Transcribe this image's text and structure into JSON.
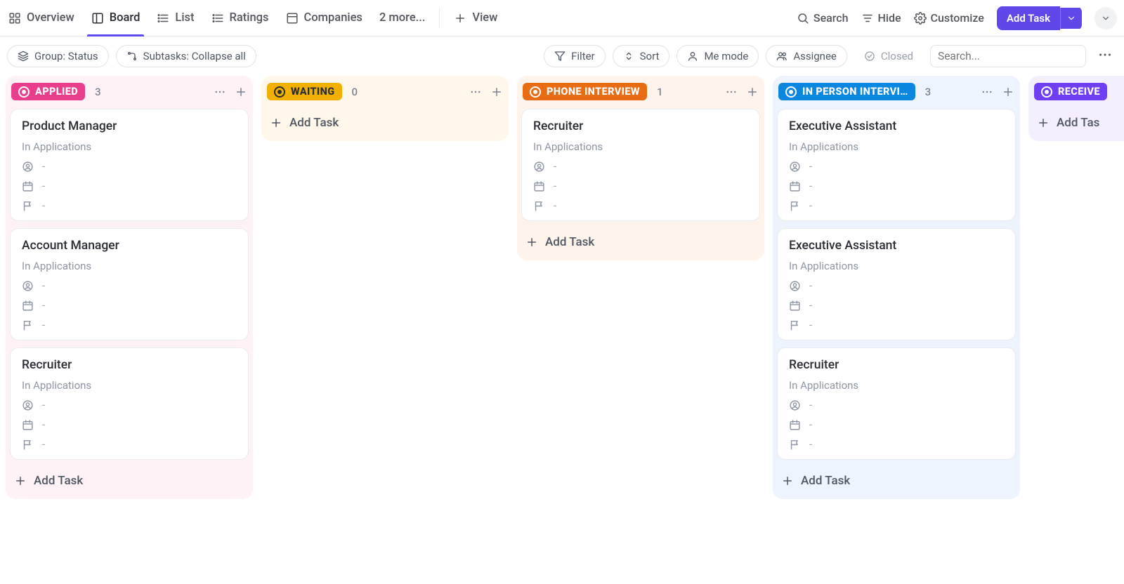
{
  "nav": {
    "tabs": [
      {
        "id": "overview",
        "label": "Overview",
        "icon": "grid"
      },
      {
        "id": "board",
        "label": "Board",
        "icon": "board",
        "active": true
      },
      {
        "id": "list",
        "label": "List",
        "icon": "list-bullets"
      },
      {
        "id": "ratings",
        "label": "Ratings",
        "icon": "list-bullets"
      },
      {
        "id": "companies",
        "label": "Companies",
        "icon": "panel"
      },
      {
        "id": "more",
        "label": "2 more...",
        "icon": null
      }
    ],
    "view_label": "View",
    "right": [
      {
        "id": "search",
        "label": "Search",
        "icon": "search"
      },
      {
        "id": "hide",
        "label": "Hide",
        "icon": "hide"
      },
      {
        "id": "customize",
        "label": "Customize",
        "icon": "gear"
      }
    ],
    "add_task": "Add Task"
  },
  "toolbar": {
    "group": "Group: Status",
    "subtasks": "Subtasks: Collapse all",
    "filter": "Filter",
    "sort": "Sort",
    "me": "Me mode",
    "assignee": "Assignee",
    "closed": "Closed",
    "search_placeholder": "Search...",
    "more": "⋯"
  },
  "board": {
    "columns": [
      {
        "id": "applied",
        "label": "APPLIED",
        "count": 3,
        "pill_bg": "#e83e8c",
        "pill_text": "#ffffff",
        "tint": "tint-pink",
        "dot_style": "light",
        "cards": [
          {
            "title": "Product Manager",
            "loc": "In Applications"
          },
          {
            "title": "Account Manager",
            "loc": "In Applications"
          },
          {
            "title": "Recruiter",
            "loc": "In Applications"
          }
        ],
        "add_label": "Add Task"
      },
      {
        "id": "waiting",
        "label": "WAITING",
        "count": 0,
        "pill_bg": "#f2b100",
        "pill_text": "#2a2e34",
        "tint": "tint-amber",
        "dot_style": "dark",
        "cards": [],
        "add_label": "Add Task"
      },
      {
        "id": "phone",
        "label": "PHONE INTERVIEW",
        "count": 1,
        "pill_bg": "#e86c13",
        "pill_text": "#ffffff",
        "tint": "tint-orange",
        "dot_style": "light",
        "cards": [
          {
            "title": "Recruiter",
            "loc": "In Applications"
          }
        ],
        "add_label": "Add Task"
      },
      {
        "id": "inperson",
        "label": "IN PERSON INTERVI…",
        "count": 3,
        "pill_bg": "#0b87e0",
        "pill_text": "#ffffff",
        "tint": "tint-blue",
        "dot_style": "light",
        "cards": [
          {
            "title": "Executive Assistant",
            "loc": "In Applications"
          },
          {
            "title": "Executive Assistant",
            "loc": "In Applications"
          },
          {
            "title": "Recruiter",
            "loc": "In Applications"
          }
        ],
        "add_label": "Add Task"
      },
      {
        "id": "received",
        "label": "RECEIVE",
        "count": null,
        "pill_bg": "#6f3ff5",
        "pill_text": "#ffffff",
        "tint": "tint-violet",
        "dot_style": "light",
        "cards": [],
        "add_label": "Add Tas"
      }
    ],
    "card_meta_placeholder": "-"
  }
}
